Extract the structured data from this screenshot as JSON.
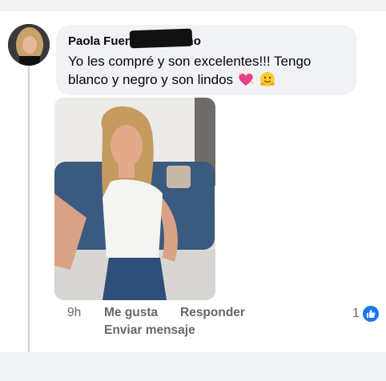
{
  "comment": {
    "author": "Paola Fuentes Lezcano",
    "text": "Yo les compré y son excelentes!!! Tengo blanco y negro y son lindos",
    "emojis": [
      "sparkling-heart-icon",
      "hugging-face-icon"
    ],
    "time": "9h",
    "actions": {
      "like": "Me gusta",
      "reply": "Responder",
      "send_message": "Enviar mensaje"
    },
    "reaction_count": "1",
    "reaction_type": "like-icon"
  },
  "colors": {
    "page_bg": "#f0f2f5",
    "bubble_bg": "#f0f2f5",
    "meta_text": "#65676b",
    "like_blue": "#1877f2"
  }
}
